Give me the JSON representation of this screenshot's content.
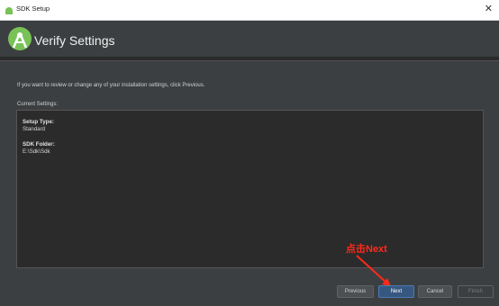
{
  "window": {
    "title": "SDK Setup",
    "close_glyph": "✕"
  },
  "header": {
    "title": "Verify Settings",
    "logo_icon": "android-studio-logo"
  },
  "intro_text": "If you want to review or change any of your installation settings, click Previous.",
  "current_settings": {
    "label": "Current Settings:",
    "setup_type_label": "Setup Type:",
    "setup_type_value": "Standard",
    "sdk_folder_label": "SDK Folder:",
    "sdk_folder_value": "E:\\Sdk\\Sdk"
  },
  "annotation": {
    "text": "点击Next",
    "color": "#ff2a1a"
  },
  "buttons": {
    "previous": "Previous",
    "next": "Next",
    "cancel": "Cancel",
    "finish": "Finish"
  },
  "colors": {
    "accent": "#365880",
    "background": "#3c3f41"
  }
}
